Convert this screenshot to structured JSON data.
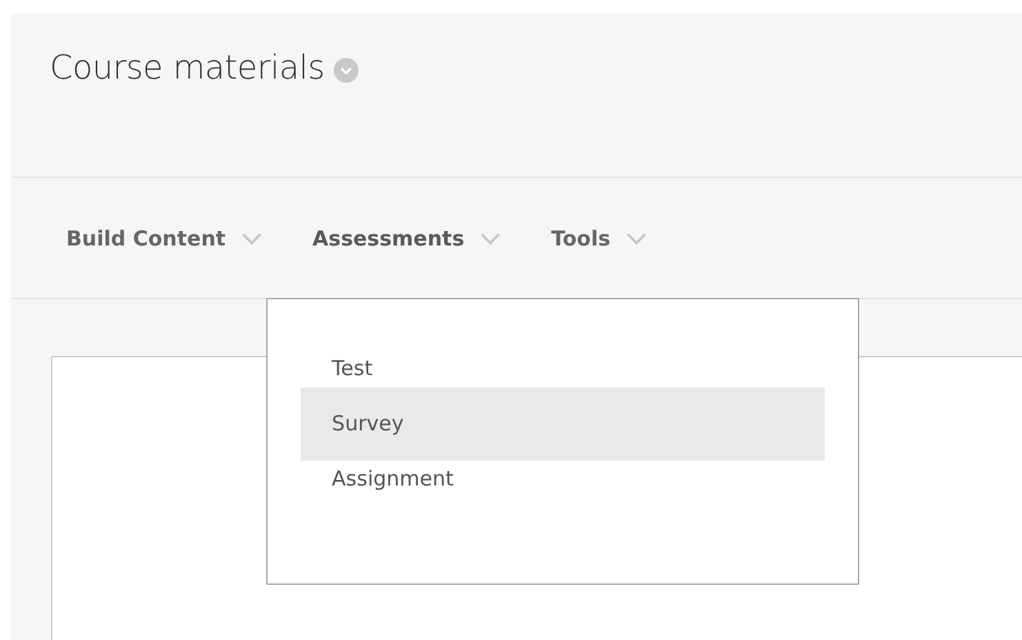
{
  "page": {
    "title": "Course materials"
  },
  "toolbar": [
    {
      "label": "Build Content",
      "expanded": false
    },
    {
      "label": "Assessments",
      "expanded": true
    },
    {
      "label": "Tools",
      "expanded": false
    }
  ],
  "menu": [
    {
      "label": "Test",
      "selected": false
    },
    {
      "label": "Survey",
      "selected": true
    },
    {
      "label": "Assignment",
      "selected": false
    }
  ]
}
